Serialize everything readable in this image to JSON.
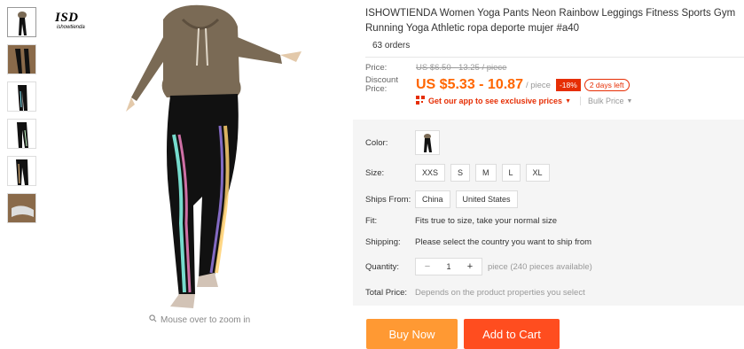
{
  "logo": {
    "text": "ISD",
    "sub": "ishowtienda"
  },
  "zoom_hint": "Mouse over to zoom in",
  "product": {
    "title": "ISHOWTIENDA Women Yoga Pants Neon Rainbow Leggings Fitness Sports Gym Running Yoga Athletic ropa deporte mujer #a40",
    "orders": "63 orders"
  },
  "price": {
    "label": "Price:",
    "original": "US $6.50 - 13.25 / piece",
    "discount_label": "Discount Price:",
    "discount": "US $5.33 - 10.87",
    "per": "/ piece",
    "off": "-18%",
    "days_left": "2 days left",
    "app_text": "Get our app to see exclusive prices",
    "bulk": "Bulk Price"
  },
  "spec": {
    "color_label": "Color:",
    "size_label": "Size:",
    "sizes": [
      "XXS",
      "S",
      "M",
      "L",
      "XL"
    ],
    "ships_label": "Ships From:",
    "ships": [
      "China",
      "United States"
    ],
    "fit_label": "Fit:",
    "fit_value": "Fits true to size, take your normal size",
    "shipping_label": "Shipping:",
    "shipping_value": "Please select the country you want to ship from",
    "qty_label": "Quantity:",
    "qty_minus": "−",
    "qty_value": "1",
    "qty_plus": "+",
    "qty_avail": "piece (240 pieces available)",
    "total_label": "Total Price:",
    "total_value": "Depends on the product properties you select"
  },
  "buttons": {
    "buy": "Buy Now",
    "cart": "Add to Cart"
  },
  "colors": {
    "accent": "#e62e04",
    "orange": "#ff9933",
    "cart": "#ff4d1f"
  }
}
